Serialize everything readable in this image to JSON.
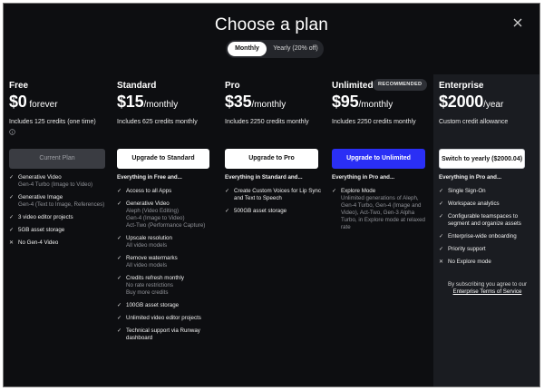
{
  "header": {
    "title": "Choose a plan"
  },
  "billing_toggle": {
    "monthly": "Monthly",
    "yearly": "Yearly (20% off)"
  },
  "plans": [
    {
      "name": "Free",
      "price": "$0",
      "period": " forever",
      "credits": "Includes 125 credits (one time)",
      "button": "Current Plan",
      "features_header": "",
      "features": [
        {
          "text": "Generative Video",
          "sub": "Gen-4 Turbo (Image to Video)",
          "icon": "check"
        },
        {
          "text": "Generative Image",
          "sub": "Gen-4 (Text to Image, References)",
          "icon": "check"
        },
        {
          "text": "3 video editor projects",
          "sub": "",
          "icon": "check"
        },
        {
          "text": "5GB asset storage",
          "sub": "",
          "icon": "check"
        },
        {
          "text": "No Gen-4 Video",
          "sub": "",
          "icon": "x"
        }
      ]
    },
    {
      "name": "Standard",
      "price": "$15",
      "period": "/monthly",
      "credits": "Includes 625 credits monthly",
      "button": "Upgrade to Standard",
      "features_header": "Everything in Free and...",
      "features": [
        {
          "text": "Access to all Apps",
          "sub": "",
          "icon": "check"
        },
        {
          "text": "Generative Video",
          "sub": "Aleph (Video Editing)\nGen-4 (Image to Video)\nAct-Two (Performance Capture)",
          "icon": "check"
        },
        {
          "text": "Upscale resolution",
          "sub": "All video models",
          "icon": "check"
        },
        {
          "text": "Remove watermarks",
          "sub": "All video models",
          "icon": "check"
        },
        {
          "text": "Credits refresh monthly",
          "sub": "No rate restrictions\nBuy more credits",
          "icon": "check"
        },
        {
          "text": "100GB asset storage",
          "sub": "",
          "icon": "check"
        },
        {
          "text": "Unlimited video editor projects",
          "sub": "",
          "icon": "check"
        },
        {
          "text": "Technical support via Runway dashboard",
          "sub": "",
          "icon": "check"
        }
      ]
    },
    {
      "name": "Pro",
      "price": "$35",
      "period": "/monthly",
      "credits": "Includes 2250 credits monthly",
      "button": "Upgrade to Pro",
      "features_header": "Everything in Standard and...",
      "features": [
        {
          "text": "Create Custom Voices for Lip Sync and Text to Speech",
          "sub": "",
          "icon": "check"
        },
        {
          "text": "500GB asset storage",
          "sub": "",
          "icon": "check"
        }
      ]
    },
    {
      "name": "Unlimited",
      "badge": "RECOMMENDED",
      "price": "$95",
      "period": "/monthly",
      "credits": "Includes 2250 credits monthly",
      "button": "Upgrade to Unlimited",
      "features_header": "Everything in Pro and...",
      "features": [
        {
          "text": "Explore Mode",
          "sub": "Unlimited generations of Aleph, Gen-4 Turbo, Gen-4 (Image and Video), Act-Two, Gen-3 Alpha Turbo, in Explore mode at relaxed rate",
          "icon": "check"
        }
      ]
    },
    {
      "name": "Enterprise",
      "price": "$2000",
      "period": "/year",
      "credits": "Custom credit allowance",
      "button": "Switch to yearly ($2000.04)",
      "features_header": "Everything in Pro and...",
      "features": [
        {
          "text": "Single Sign-On",
          "sub": "",
          "icon": "check"
        },
        {
          "text": "Workspace analytics",
          "sub": "",
          "icon": "check"
        },
        {
          "text": "Configurable teamspaces to segment and organize assets",
          "sub": "",
          "icon": "check"
        },
        {
          "text": "Enterprise-wide onboarding",
          "sub": "",
          "icon": "check"
        },
        {
          "text": "Priority support",
          "sub": "",
          "icon": "check"
        },
        {
          "text": "No Explore mode",
          "sub": "",
          "icon": "x"
        }
      ],
      "note_prefix": "By subscribing you agree to our ",
      "note_link": "Enterprise Terms of Service"
    }
  ]
}
